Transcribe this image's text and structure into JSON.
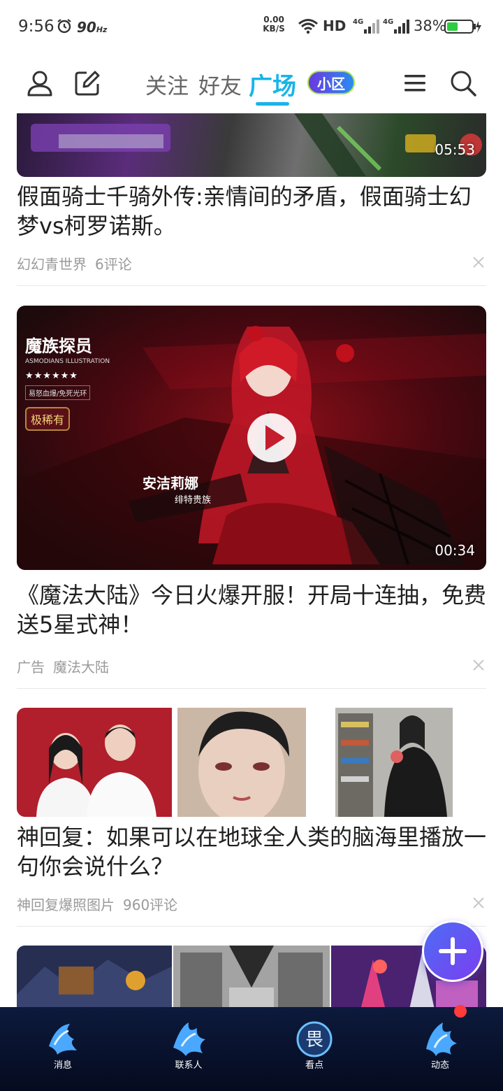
{
  "status_bar": {
    "time": "9:56",
    "refresh": "90",
    "refresh_unit": "Hz",
    "speed_value": "0.00",
    "speed_unit": "KB/S",
    "hd": "HD",
    "net1": "4G",
    "net2": "4G",
    "battery": "38%"
  },
  "header": {
    "tabs": [
      {
        "label": "关注"
      },
      {
        "label": "好友"
      },
      {
        "label": "广场"
      }
    ],
    "badge": "小区"
  },
  "feed": [
    {
      "duration": "05:53",
      "title": "假面骑士千骑外传:亲情间的矛盾，假面骑士幻梦vs柯罗诺斯。",
      "meta": [
        "幻幻青世界",
        "6评论"
      ]
    },
    {
      "duration": "00:34",
      "overlay": {
        "brand": "魔族探员",
        "brand_sub": "ASMODIANS ILLUSTRATION",
        "stars": "★★★★★★",
        "skills": "易怒血爆/免死光环",
        "rarity": "极稀有",
        "name": "安洁莉娜",
        "name_sub": "绯特贵族"
      },
      "title": "《魔法大陆》今日火爆开服！开局十连抽，免费送5星式神！",
      "meta": [
        "广告",
        "魔法大陆"
      ]
    },
    {
      "title": "神回复：如果可以在地球全人类的脑海里播放一句你会说什么？",
      "meta": [
        "神回复爆照图片",
        "960评论"
      ]
    }
  ],
  "bottom_nav": [
    {
      "label": "消息",
      "icon": "message-icon"
    },
    {
      "label": "联系人",
      "icon": "contacts-icon"
    },
    {
      "label": "看点",
      "icon": "kandian-icon"
    },
    {
      "label": "动态",
      "icon": "feed-icon"
    }
  ],
  "colors": {
    "accent": "#19b4e8",
    "nav_bg": "#0d1a3c",
    "fab": "#5b55f0"
  }
}
